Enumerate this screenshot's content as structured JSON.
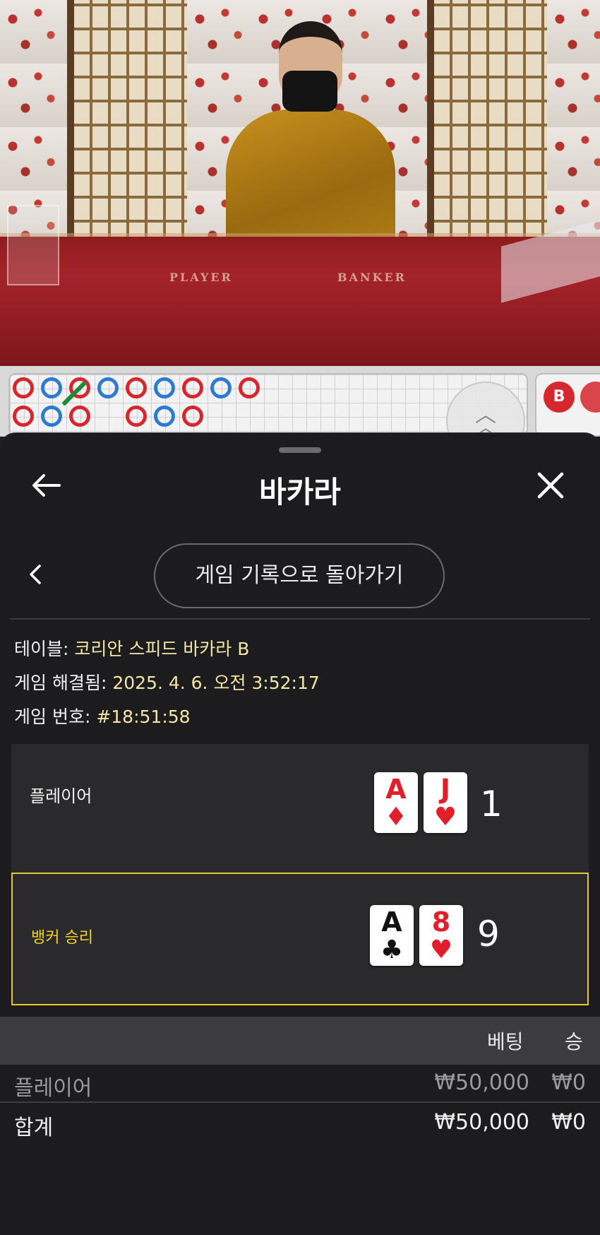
{
  "video": {
    "felt_player_label": "PLAYER",
    "felt_banker_label": "BANKER"
  },
  "roadmap": {
    "right_bead_label": "B",
    "beads": [
      {
        "col": 0,
        "row": 0,
        "side": "banker"
      },
      {
        "col": 1,
        "row": 0,
        "side": "player"
      },
      {
        "col": 2,
        "row": 0,
        "side": "banker"
      },
      {
        "col": 3,
        "row": 0,
        "side": "player"
      },
      {
        "col": 4,
        "row": 0,
        "side": "banker"
      },
      {
        "col": 5,
        "row": 0,
        "side": "player"
      },
      {
        "col": 6,
        "row": 0,
        "side": "banker"
      },
      {
        "col": 7,
        "row": 0,
        "side": "player"
      },
      {
        "col": 8,
        "row": 0,
        "side": "banker"
      },
      {
        "col": 0,
        "row": 1,
        "side": "banker"
      },
      {
        "col": 1,
        "row": 1,
        "side": "player"
      },
      {
        "col": 2,
        "row": 1,
        "side": "banker"
      },
      {
        "col": 4,
        "row": 1,
        "side": "banker"
      },
      {
        "col": 5,
        "row": 1,
        "side": "player"
      },
      {
        "col": 6,
        "row": 1,
        "side": "banker"
      }
    ]
  },
  "sheet": {
    "title": "바카라",
    "back_pill_label": "게임 기록으로 돌아가기",
    "info": {
      "table_label": "테이블:",
      "table_value": "코리안 스피드 바카라 B",
      "resolved_label": "게임 해결됨:",
      "resolved_value": "2025. 4. 6. 오전 3:52:17",
      "number_label": "게임 번호:",
      "number_value": "#18:51:58"
    },
    "player_hand": {
      "label": "플레이어",
      "cards": [
        {
          "rank": "A",
          "suit": "♦",
          "color": "red"
        },
        {
          "rank": "J",
          "suit": "♥",
          "color": "red"
        }
      ],
      "score": "1"
    },
    "banker_hand": {
      "label": "뱅커 승리",
      "cards": [
        {
          "rank": "A",
          "suit": "♣",
          "color": "black"
        },
        {
          "rank": "8",
          "suit": "♥",
          "color": "red"
        }
      ],
      "score": "9"
    },
    "table": {
      "headers": {
        "bet": "베팅",
        "win": "승"
      },
      "rows": [
        {
          "name": "플레이어",
          "bet": "₩50,000",
          "win": "₩0"
        }
      ],
      "total": {
        "name": "합계",
        "bet": "₩50,000",
        "win": "₩0"
      }
    }
  },
  "colors": {
    "sheet_bg": "#1c1b1d",
    "accent_yellow": "#e8c62f",
    "info_value": "#f3e6a6",
    "card_red": "#e01f2a"
  }
}
